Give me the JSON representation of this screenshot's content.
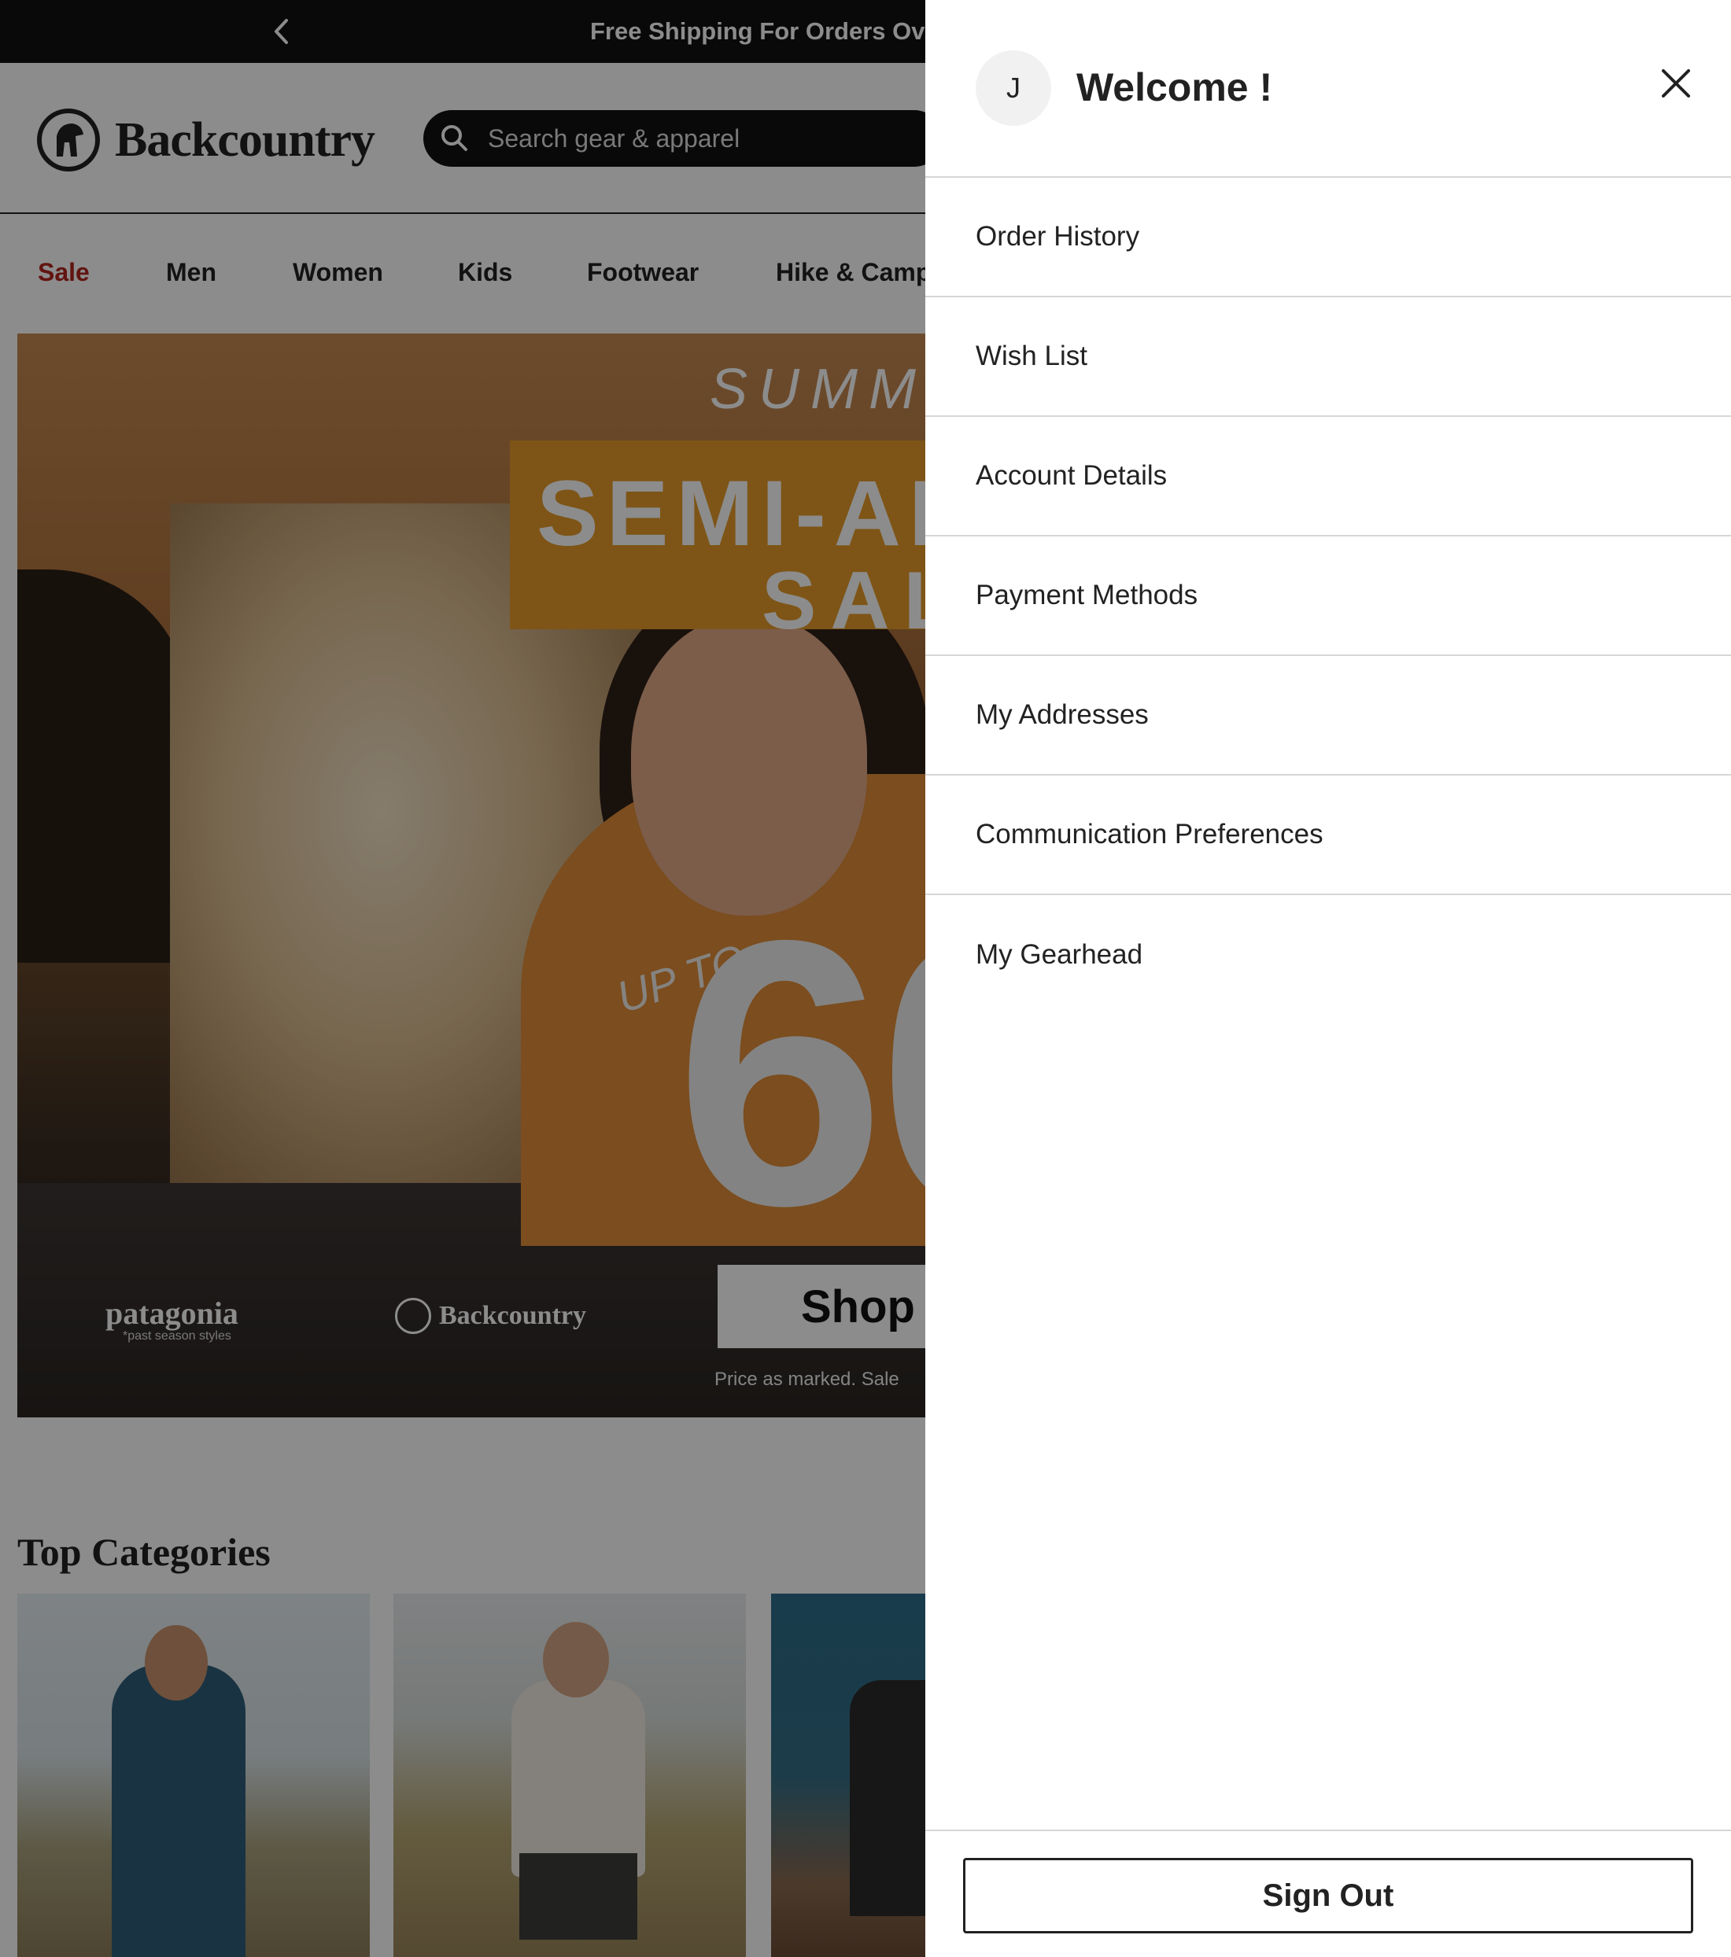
{
  "promo": {
    "text": "Free Shipping For Orders Ov"
  },
  "header": {
    "brand": "Backcountry",
    "search_placeholder": "Search gear & apparel"
  },
  "nav": {
    "items": [
      "Sale",
      "Men",
      "Women",
      "Kids",
      "Footwear",
      "Hike & Camp"
    ]
  },
  "hero": {
    "summer": "SUMM",
    "semi": "SEMI-AN",
    "sale": "SAL",
    "up_to": "UP TO",
    "percent": "60",
    "brand_patagonia": "patagonia",
    "brand_patagonia_sub": "*past season styles",
    "brand_backcountry": "Backcountry",
    "cta": "Shop Nov",
    "fine_print": "Price as marked. Sale"
  },
  "top_categories": {
    "title": "Top Categories"
  },
  "drawer": {
    "avatar_initial": "J",
    "welcome": "Welcome !",
    "menu": [
      "Order History",
      "Wish List",
      "Account Details",
      "Payment Methods",
      "My Addresses",
      "Communication Preferences",
      "My Gearhead"
    ],
    "sign_out": "Sign Out"
  },
  "colors": {
    "sale": "#b3261e",
    "promo_bar": "#111111",
    "overlay": "rgba(0,0,0,0.45)"
  },
  "icons": [
    "chevron-left-icon",
    "search-icon",
    "close-icon",
    "backcountry-logo-icon"
  ]
}
